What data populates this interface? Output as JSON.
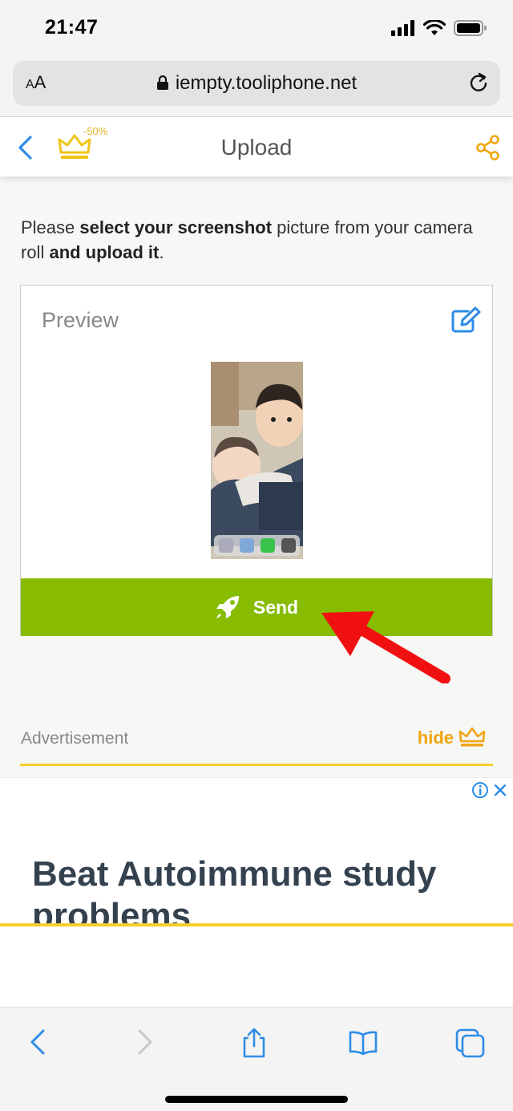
{
  "status_bar": {
    "time": "21:47"
  },
  "browser": {
    "aa_label_small": "A",
    "aa_label_large": "A",
    "url": "iempty.tooliphone.net"
  },
  "header": {
    "title": "Upload",
    "discount_badge": "-50%"
  },
  "instructions": {
    "part1": "Please ",
    "bold1": "select your screenshot",
    "part2": " picture from your camera roll ",
    "bold2": "and upload it",
    "part3": "."
  },
  "preview": {
    "title": "Preview",
    "send_label": "Send"
  },
  "ad": {
    "label": "Advertisement",
    "hide_label": "hide",
    "headline": "Beat Autoimmune study problems"
  },
  "colors": {
    "accent_blue": "#2e8ce6",
    "send_green": "#87bc02",
    "crown_yellow": "#f0c419",
    "share_orange": "#f0a510",
    "arrow_red": "#f01010"
  },
  "icons": {
    "back": "chevron-left-icon",
    "crown": "crown-icon",
    "share": "share-icon",
    "edit": "edit-icon",
    "rocket": "rocket-icon",
    "lock": "lock-icon",
    "reload": "reload-icon"
  }
}
